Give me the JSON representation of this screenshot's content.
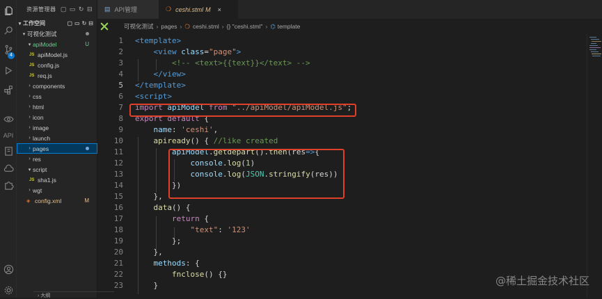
{
  "activity_bar": {
    "icons": [
      "files-icon",
      "search-icon",
      "source-control-icon",
      "run-debug-icon",
      "extensions-icon",
      "eye-icon",
      "api-icon",
      "document-icon",
      "cloud-icon",
      "puzzle-icon",
      "account-icon",
      "settings-icon"
    ],
    "api_label": "API",
    "scm_badge": "4"
  },
  "sidebar": {
    "title": "资源管理器",
    "tools": "⋯",
    "section": "工作空间",
    "project": "可视化测试",
    "items": [
      {
        "label": "apiModel",
        "type": "folder",
        "open": true,
        "depth": 1,
        "status": "U",
        "status_color": "green"
      },
      {
        "label": "apiModel.js",
        "type": "js",
        "depth": 2
      },
      {
        "label": "config.js",
        "type": "js",
        "depth": 2
      },
      {
        "label": "req.js",
        "type": "js",
        "depth": 2
      },
      {
        "label": "components",
        "type": "folder",
        "depth": 1
      },
      {
        "label": "css",
        "type": "folder",
        "depth": 1
      },
      {
        "label": "html",
        "type": "folder",
        "depth": 1
      },
      {
        "label": "icon",
        "type": "folder",
        "depth": 1
      },
      {
        "label": "image",
        "type": "folder",
        "depth": 1
      },
      {
        "label": "launch",
        "type": "folder",
        "depth": 1
      },
      {
        "label": "pages",
        "type": "folder",
        "depth": 1,
        "selected": true
      },
      {
        "label": "res",
        "type": "folder",
        "depth": 1
      },
      {
        "label": "script",
        "type": "folder",
        "open": true,
        "depth": 1
      },
      {
        "label": "sha1.js",
        "type": "js",
        "depth": 2
      },
      {
        "label": "wgt",
        "type": "folder",
        "depth": 1
      },
      {
        "label": "config.xml",
        "type": "xml",
        "depth": 1,
        "status": "M",
        "status_color": "gold"
      }
    ],
    "outline_label": "大纲"
  },
  "tabs": [
    {
      "label": "API管理",
      "active": false
    },
    {
      "label": "ceshi.stml",
      "modified": "M",
      "active": true,
      "close": "×"
    }
  ],
  "breadcrumb": [
    "可视化测试",
    "pages",
    "ceshi.stml",
    "{} \"ceshi.stml\"",
    "template"
  ],
  "code_lines": [
    "1",
    "2",
    "3",
    "4",
    "5",
    "6",
    "7",
    "8",
    "9",
    "10",
    "11",
    "12",
    "13",
    "14",
    "15",
    "16",
    "17",
    "18",
    "19",
    "20",
    "21",
    "22",
    "23"
  ],
  "code": {
    "l1": "<template>",
    "l2a": "<view ",
    "l2b": "class",
    "l2c": "=",
    "l2d": "\"page\"",
    "l2e": ">",
    "l3": "<!-- <text>{{text}}</text> -->",
    "l4": "</view>",
    "l5": "</template>",
    "l6": "<script>",
    "l7a": "import ",
    "l7b": "apiModel ",
    "l7c": "from ",
    "l7d": "\"../apiModel/apiModel.js\"",
    "l7e": ";",
    "l8a": "export default ",
    "l8b": "{",
    "l9a": "name",
    "l9b": ": ",
    "l9c": "'ceshi'",
    "l9d": ",",
    "l10a": "apiready",
    "l10b": "() { ",
    "l10c": "//like created",
    "l11a": "apiModel",
    "l11b": ".",
    "l11c": "getdepart",
    "l11d": "().",
    "l11e": "then",
    "l11f": "(res",
    "l11g": "=>",
    "l11h": "{",
    "l12a": "console",
    "l12b": ".",
    "l12c": "log",
    "l12d": "(",
    "l12e": "1",
    "l12f": ")",
    "l13a": "console",
    "l13b": ".",
    "l13c": "log",
    "l13d": "(",
    "l13e": "JSON",
    "l13f": ".",
    "l13g": "stringify",
    "l13h": "(res))",
    "l14": "})",
    "l15": "},",
    "l16a": "data",
    "l16b": "() {",
    "l17a": "return ",
    "l17b": "{",
    "l18a": "\"text\"",
    "l18b": ": ",
    "l18c": "'123'",
    "l19": "};",
    "l20": "},",
    "l21a": "methods",
    "l21b": ": {",
    "l22a": "fnclose",
    "l22b": "() {}",
    "l23": "}"
  },
  "watermark": "@稀土掘金技术社区"
}
